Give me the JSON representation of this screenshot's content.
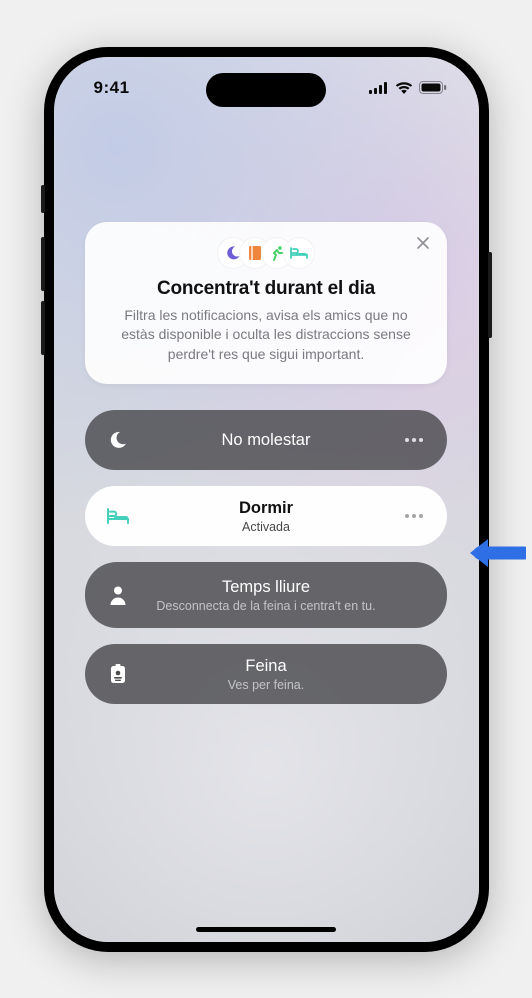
{
  "status": {
    "time": "9:41"
  },
  "intro": {
    "title": "Concentra't durant el dia",
    "description": "Filtra les notificacions, avisa els amics que no estàs disponible i oculta les distraccions sense perdre't res que sigui important.",
    "icons": [
      "moon-icon",
      "book-icon",
      "running-icon",
      "bed-icon"
    ]
  },
  "focus_modes": [
    {
      "key": "dnd",
      "title": "No molestar",
      "subtitle": "",
      "active": false,
      "icon": "moon-icon",
      "has_more": true
    },
    {
      "key": "sleep",
      "title": "Dormir",
      "subtitle": "Activada",
      "active": true,
      "icon": "bed-icon",
      "has_more": true
    },
    {
      "key": "personal",
      "title": "Temps lliure",
      "subtitle": "Desconnecta de la feina i centra't en tu.",
      "active": false,
      "icon": "person-icon",
      "has_more": false
    },
    {
      "key": "work",
      "title": "Feina",
      "subtitle": "Ves per feina.",
      "active": false,
      "icon": "badge-icon",
      "has_more": false
    }
  ],
  "colors": {
    "dark_pill": "rgba(75,75,78,.82)",
    "light_pill": "rgba(255,255,255,.96)",
    "teal": "#44d0bb",
    "purple": "#6d5ed6",
    "orange": "#f0863d",
    "green": "#48d267",
    "arrow": "#2e6fe6"
  }
}
